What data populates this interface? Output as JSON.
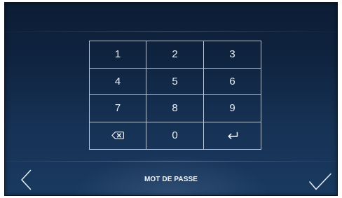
{
  "screen": {
    "title": "MOT DE PASSE"
  },
  "keypad": {
    "keys": [
      "1",
      "2",
      "3",
      "4",
      "5",
      "6",
      "7",
      "8",
      "9",
      "0"
    ],
    "delete_icon": "backspace-icon",
    "enter_icon": "enter-icon"
  },
  "navigation": {
    "back_icon": "chevron-left-icon",
    "confirm_icon": "checkmark-icon"
  },
  "colors": {
    "background_top": "#0c1d35",
    "background_bottom": "#1a3a60",
    "line": "#dce8f8",
    "text": "#eaf0f8"
  }
}
